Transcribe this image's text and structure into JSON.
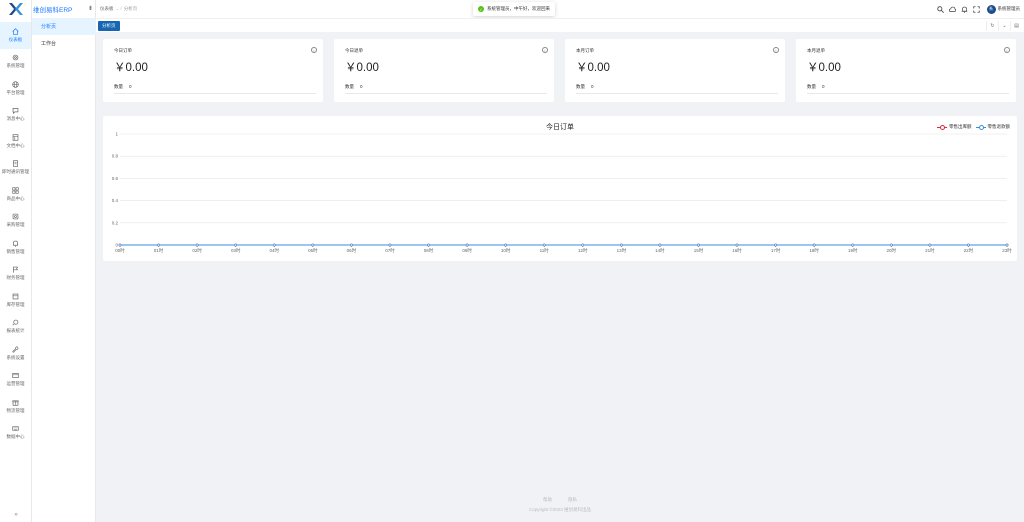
{
  "brand": {
    "name": "维创易科ERP"
  },
  "sidebar": {
    "items": [
      {
        "label": "仪表板",
        "icon": "home-icon",
        "active": true
      },
      {
        "label": "系统管理",
        "icon": "gear-icon"
      },
      {
        "label": "平台管理",
        "icon": "globe-icon"
      },
      {
        "label": "消息中心",
        "icon": "chat-icon"
      },
      {
        "label": "文档中心",
        "icon": "document-icon"
      },
      {
        "label": "即时通讯管理",
        "icon": "clipboard-icon"
      },
      {
        "label": "商品中心",
        "icon": "grid-icon"
      },
      {
        "label": "采购管理",
        "icon": "cart-icon"
      },
      {
        "label": "销售管理",
        "icon": "bell-icon"
      },
      {
        "label": "财务管理",
        "icon": "flag-icon"
      },
      {
        "label": "库存管理",
        "icon": "box-icon"
      },
      {
        "label": "报表统计",
        "icon": "search-icon"
      },
      {
        "label": "系统设置",
        "icon": "wrench-icon"
      },
      {
        "label": "运营管理",
        "icon": "card-icon"
      },
      {
        "label": "物流管理",
        "icon": "gift-icon"
      },
      {
        "label": "数据中心",
        "icon": "keyboard-icon"
      }
    ],
    "collapse_glyph": "»"
  },
  "submenu": {
    "items": [
      {
        "label": "分析页",
        "active": true
      },
      {
        "label": "工作台",
        "active": false
      }
    ]
  },
  "header": {
    "breadcrumb": {
      "root": "仪表板",
      "current": "分析页"
    },
    "toast": "系统管理员，中午好，欢迎回来",
    "user_name": "系统管理员",
    "avatar_text": "系"
  },
  "tabs": {
    "active": "分析页"
  },
  "cards": [
    {
      "title": "今日订单",
      "value": "￥0.00",
      "count_label": "数量",
      "count": "0"
    },
    {
      "title": "今日退单",
      "value": "￥0.00",
      "count_label": "数量",
      "count": "0"
    },
    {
      "title": "本月订单",
      "value": "￥0.00",
      "count_label": "数量",
      "count": "0"
    },
    {
      "title": "本月退单",
      "value": "￥0.00",
      "count_label": "数量",
      "count": "0"
    }
  ],
  "chart_data": {
    "type": "line",
    "title": "今日订单",
    "categories": [
      "00时",
      "01时",
      "02时",
      "03时",
      "04时",
      "05时",
      "06时",
      "07时",
      "08时",
      "09时",
      "10时",
      "11时",
      "12时",
      "13时",
      "14时",
      "15时",
      "16时",
      "17时",
      "18时",
      "19时",
      "20时",
      "21时",
      "22时",
      "23时"
    ],
    "series": [
      {
        "name": "零售出库额",
        "color": "#e0293b",
        "values": [
          0,
          0,
          0,
          0,
          0,
          0,
          0,
          0,
          0,
          0,
          0,
          0,
          0,
          0,
          0,
          0,
          0,
          0,
          0,
          0,
          0,
          0,
          0,
          0
        ]
      },
      {
        "name": "零售退款额",
        "color": "#3a8fd9",
        "values": [
          0,
          0,
          0,
          0,
          0,
          0,
          0,
          0,
          0,
          0,
          0,
          0,
          0,
          0,
          0,
          0,
          0,
          0,
          0,
          0,
          0,
          0,
          0,
          0
        ]
      }
    ],
    "y_ticks": [
      "0",
      "0.2",
      "0.4",
      "0.6",
      "0.8",
      "1"
    ],
    "ylim": [
      0,
      1
    ],
    "grid": true,
    "legend": "top-right",
    "colors": {
      "axis": "#333333",
      "grid": "#e6e6e6"
    }
  },
  "footer": {
    "links": [
      "帮助",
      "隐私"
    ],
    "copyright": "Copyright ©2023 维创易科出品"
  }
}
